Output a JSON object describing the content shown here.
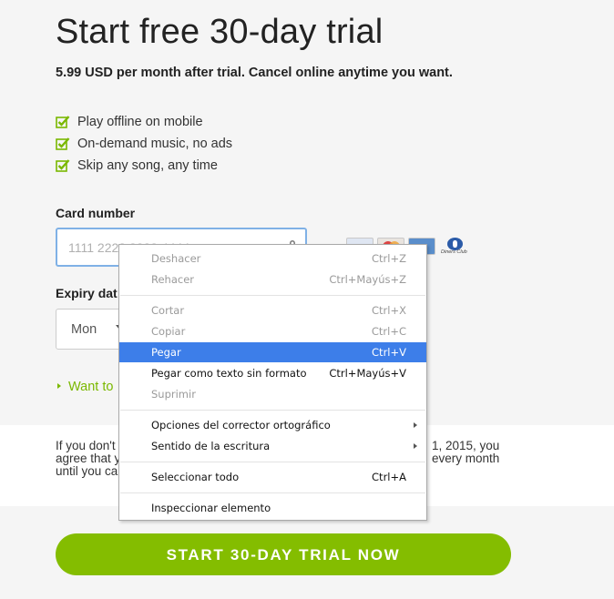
{
  "header": {
    "title": "Start free 30-day trial",
    "subtitle": "5.99 USD per month after trial. Cancel online anytime you want."
  },
  "features": [
    "Play offline on mobile",
    "On-demand music, no ads",
    "Skip any song, any time"
  ],
  "card": {
    "label": "Card number",
    "placeholder": "1111 2222 3333 4444",
    "logos": [
      "visa",
      "mastercard",
      "amex",
      "diners-club"
    ],
    "diners_text": "Diners Club"
  },
  "expiry": {
    "label": "Expiry dat",
    "month": "Mon"
  },
  "want_link": "Want to",
  "terms": {
    "left_lines": "If you don't\nagree that y\nuntil you ca",
    "right_lines": "1, 2015, you\nevery month"
  },
  "cta_label": "START 30-DAY TRIAL NOW",
  "context_menu": {
    "items": [
      {
        "label": "Deshacer",
        "shortcut": "Ctrl+Z",
        "state": "disabled"
      },
      {
        "label": "Rehacer",
        "shortcut": "Ctrl+Mayús+Z",
        "state": "disabled"
      },
      {
        "label": "Cortar",
        "shortcut": "Ctrl+X",
        "state": "disabled"
      },
      {
        "label": "Copiar",
        "shortcut": "Ctrl+C",
        "state": "disabled"
      },
      {
        "label": "Pegar",
        "shortcut": "Ctrl+V",
        "state": "highlighted"
      },
      {
        "label": "Pegar como texto sin formato",
        "shortcut": "Ctrl+Mayús+V",
        "state": "enabled"
      },
      {
        "label": "Suprimir",
        "shortcut": "",
        "state": "disabled"
      },
      {
        "label": "Opciones del corrector ortográfico",
        "shortcut": "",
        "state": "submenu"
      },
      {
        "label": "Sentido de la escritura",
        "shortcut": "",
        "state": "submenu"
      },
      {
        "label": "Seleccionar todo",
        "shortcut": "Ctrl+A",
        "state": "enabled"
      },
      {
        "label": "Inspeccionar elemento",
        "shortcut": "",
        "state": "enabled"
      }
    ]
  },
  "colors": {
    "accent_green": "#84bd00",
    "menu_highlight": "#3d7ee9",
    "input_focus": "#7fb1e6"
  }
}
